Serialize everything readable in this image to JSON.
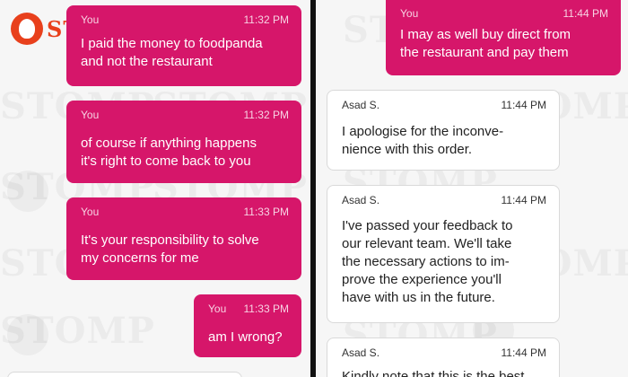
{
  "logo": {
    "text": "STOMP"
  },
  "watermark": {
    "text": "STOMP"
  },
  "colors": {
    "sent_bubble": "#d6166a",
    "received_bubble": "#ffffff",
    "logo": "#e8401c"
  },
  "left_messages": [
    {
      "sender": "You",
      "time": "11:32 PM",
      "text": "I paid the money to foodpanda\nand not the restaurant"
    },
    {
      "sender": "You",
      "time": "11:32 PM",
      "text": "of course if anything happens\nit's right to come back to you"
    },
    {
      "sender": "You",
      "time": "11:33 PM",
      "text": "It's your responsibility to solve\nmy concerns for me"
    },
    {
      "sender": "You",
      "time": "11:33 PM",
      "text": "am I wrong?"
    }
  ],
  "right_messages": [
    {
      "sender": "You",
      "time": "11:44 PM",
      "text": "I may as well buy direct from\nthe restaurant and pay them"
    },
    {
      "sender": "Asad S.",
      "time": "11:44 PM",
      "text": "I apologise for the inconve-\nnience with this order."
    },
    {
      "sender": "Asad S.",
      "time": "11:44 PM",
      "text": "I've passed your feedback to\nour relevant team. We'll take\nthe necessary actions to im-\nprove the experience you'll\nhave with us in the future."
    },
    {
      "sender": "Asad S.",
      "time": "11:44 PM",
      "text": "Kindly note that this is the best"
    }
  ]
}
